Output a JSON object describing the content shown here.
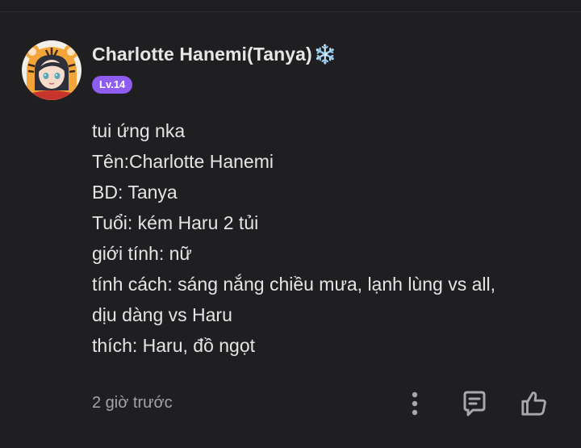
{
  "comment": {
    "username": "Charlotte Hanemi(Tanya)",
    "username_emoji": "❄️",
    "level_badge": "Lv.14",
    "lines": [
      "tui ứng nka",
      "Tên:Charlotte Hanemi",
      "BD: Tanya",
      "Tuổi: kém Haru 2 tủi",
      "giới tính: nữ",
      "tính cách: sáng nắng chiều mưa, lạnh lùng vs all,",
      "dịu dàng vs Haru",
      "thích: Haru, đồ ngọt"
    ],
    "timestamp": "2 giờ trước"
  },
  "icons": {
    "avatar": "tiger-hood-avatar",
    "more": "more-vertical-icon",
    "reply": "reply-bubble-icon",
    "like": "thumbs-up-icon"
  },
  "colors": {
    "background": "#1f1f22",
    "badge": "#8f5cf0",
    "text": "#e5e5e6",
    "muted": "#a4a4a8"
  }
}
